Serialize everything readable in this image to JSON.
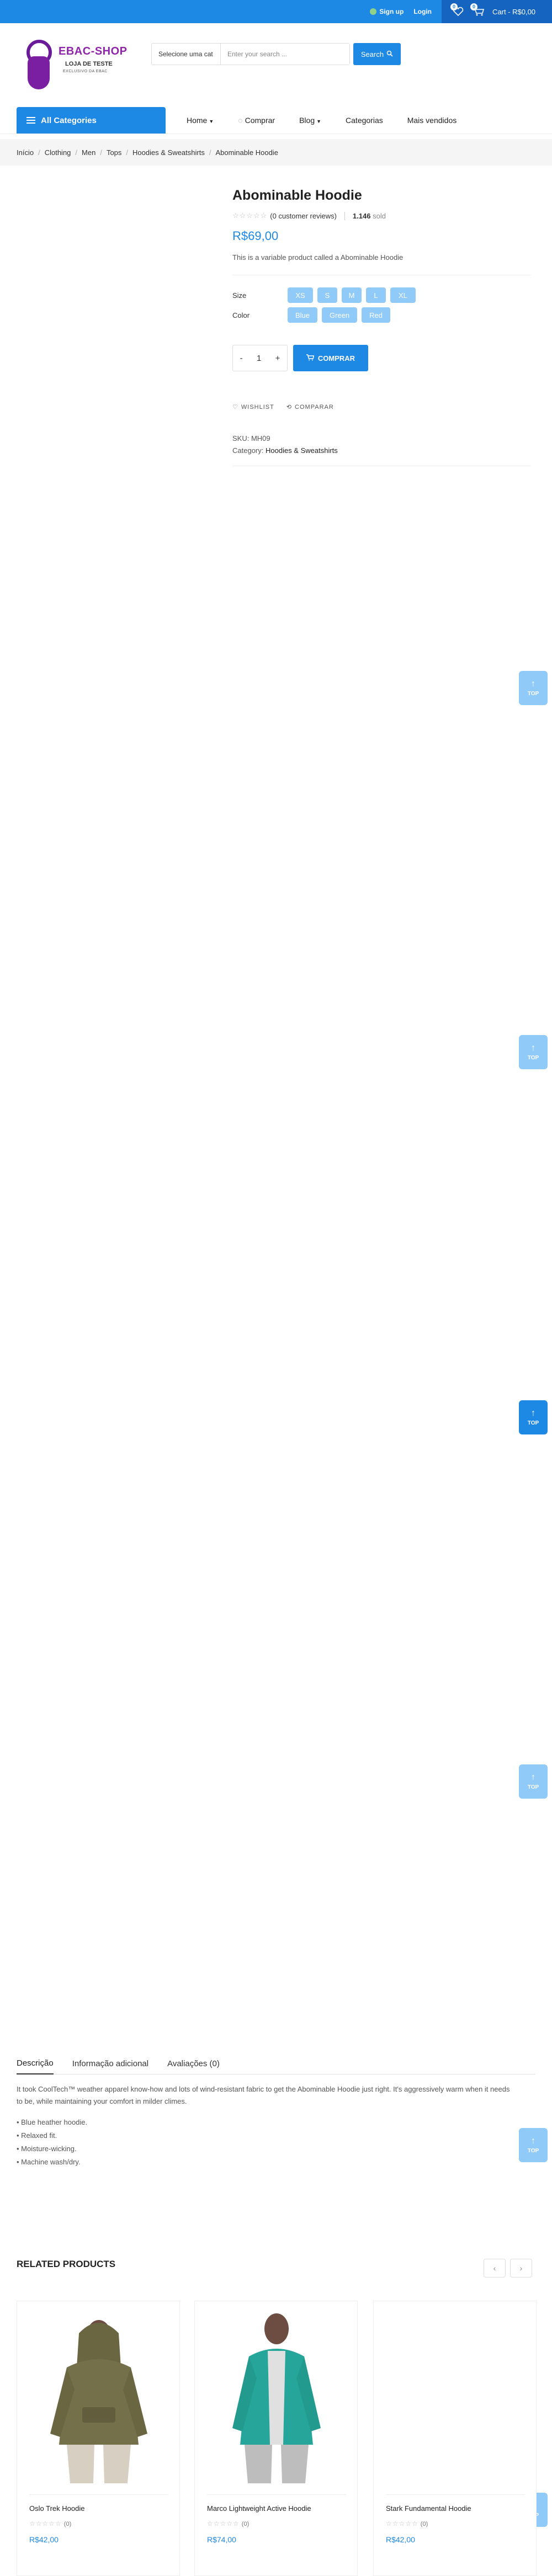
{
  "topbar": {
    "signup": "Sign up",
    "login": "Login",
    "wishlist_count": "0",
    "cart_count": "0",
    "cart_label": "Cart - R$0,00"
  },
  "logo": {
    "title": "EBAC-SHOP",
    "subtitle": "LOJA DE TESTE",
    "tagline": "EXCLUSIVO DA EBAC"
  },
  "search": {
    "category": "Selecione uma cat",
    "placeholder": "Enter your search ...",
    "button": "Search"
  },
  "nav": {
    "all_categories": "All Categories",
    "items": [
      {
        "label": "Home",
        "has_caret": true
      },
      {
        "label": "Comprar",
        "has_caret": false
      },
      {
        "label": "Blog",
        "has_caret": true
      },
      {
        "label": "Categorias",
        "has_caret": false
      },
      {
        "label": "Mais vendidos",
        "has_caret": false
      }
    ]
  },
  "breadcrumb": [
    "Início",
    "Clothing",
    "Men",
    "Tops",
    "Hoodies & Sweatshirts",
    "Abominable Hoodie"
  ],
  "product": {
    "title": "Abominable Hoodie",
    "reviews": "(0 customer reviews)",
    "sold_count": "1.146",
    "sold_label": "sold",
    "price": "R$69,00",
    "description": "This is a variable product called a Abominable Hoodie",
    "size_label": "Size",
    "sizes": [
      "XS",
      "S",
      "M",
      "L",
      "XL"
    ],
    "color_label": "Color",
    "colors": [
      "Blue",
      "Green",
      "Red"
    ],
    "quantity": "1",
    "buy_button": "COMPRAR",
    "wishlist": "WISHLIST",
    "compare": "COMPARAR",
    "sku_label": "SKU:",
    "sku": "MH09",
    "category_label": "Category:",
    "category": "Hoodies & Sweatshirts"
  },
  "top_button": "TOP",
  "tabs": [
    {
      "label": "Descrição",
      "active": true
    },
    {
      "label": "Informação adicional",
      "active": false
    },
    {
      "label": "Avaliações (0)",
      "active": false
    }
  ],
  "description": {
    "text": "It took CoolTech™ weather apparel know-how and lots of wind-resistant fabric to get the Abominable Hoodie just right. It's aggressively warm when it needs to be, while maintaining your comfort in milder climes.",
    "bullets": [
      "• Blue heather hoodie.",
      "• Relaxed fit.",
      "• Moisture-wicking.",
      "• Machine wash/dry."
    ]
  },
  "related": {
    "title": "RELATED PRODUCTS",
    "products": [
      {
        "name": "Oslo Trek Hoodie",
        "reviews": "(0)",
        "price": "R$42,00"
      },
      {
        "name": "Marco Lightweight Active Hoodie",
        "reviews": "(0)",
        "price": "R$74,00"
      },
      {
        "name": "Stark Fundamental Hoodie",
        "reviews": "(0)",
        "price": "R$42,00"
      }
    ]
  },
  "colors": {
    "primary": "#1e88e5",
    "primary_dark": "#1565c0",
    "option_bg": "#90caf9",
    "logo_purple": "#8e24aa"
  }
}
